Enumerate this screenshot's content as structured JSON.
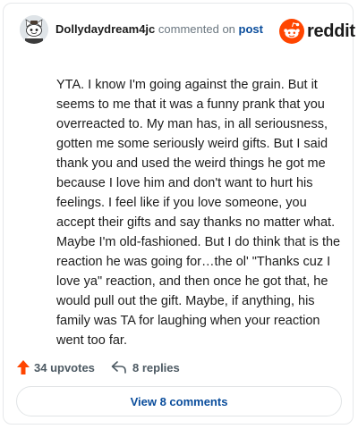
{
  "header": {
    "username": "Dollydaydream4jc",
    "action_text": "commented on",
    "post_link": "post",
    "brand_word": "reddit"
  },
  "comment": {
    "body": "YTA. I know I'm going against the grain. But it seems to me that it was a funny prank that you overreacted to. My man has, in all seriousness, gotten me some seriously weird gifts. But I said thank you and used the weird things he got me because I love him and don't want to hurt his feelings. I feel like if you love someone, you accept their gifts and say thanks no matter what. Maybe I'm old-fashioned. But I do think that is the reaction he was going for…the ol' \"Thanks cuz I love ya\" reaction, and then once he got that, he would pull out the gift. Maybe, if anything, his family was TA for laughing when your reaction went too far."
  },
  "actions": {
    "upvotes": "34 upvotes",
    "replies": "8 replies"
  },
  "footer": {
    "view_comments": "View 8 comments"
  },
  "icons": {
    "avatar": "snoo-avatar-icon",
    "brand": "reddit-logo-icon",
    "upvote": "upvote-arrow-icon",
    "reply": "reply-arrow-icon"
  },
  "colors": {
    "brand_orange": "#ff4500",
    "link_blue": "#0a4d9c",
    "text_dark": "#1c1c1c",
    "text_muted": "#4d5a63"
  }
}
